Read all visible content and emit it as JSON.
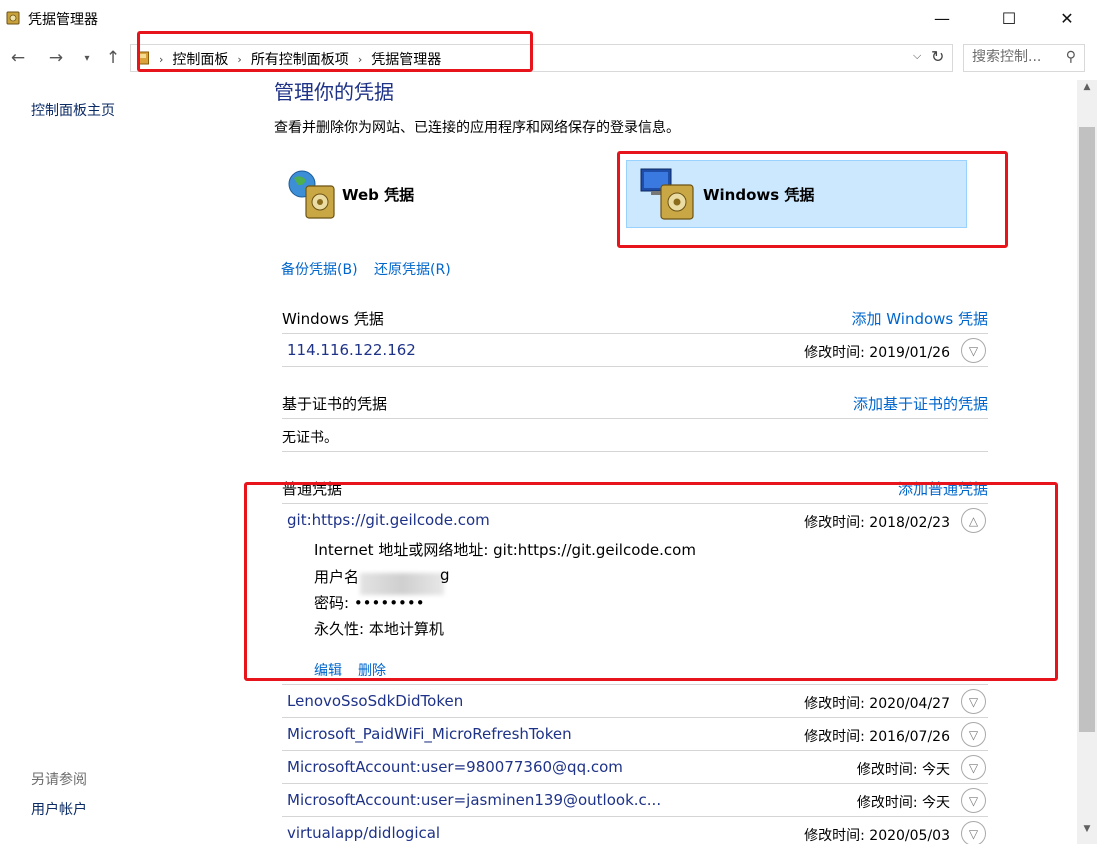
{
  "window": {
    "title": "凭据管理器",
    "minimize": "—",
    "maximize": "☐",
    "close": "✕"
  },
  "nav": {
    "back": "←",
    "forward": "→",
    "recent": "⌄",
    "up": "↑",
    "breadcrumbs": [
      "控制面板",
      "所有控制面板项",
      "凭据管理器"
    ],
    "separator": "›",
    "search_placeholder": "搜索控制...",
    "search_icon": "search-icon"
  },
  "sidebar": {
    "home": "控制面板主页",
    "see_also_title": "另请参阅",
    "see_also_items": [
      "用户帐户"
    ]
  },
  "main": {
    "heading": "管理你的凭据",
    "description": "查看并删除你为网站、已连接的应用程序和网络保存的登录信息。",
    "tiles": {
      "web": "Web 凭据",
      "windows": "Windows 凭据",
      "selected": "windows"
    },
    "backup": "备份凭据(B)",
    "restore": "还原凭据(R)"
  },
  "windows_creds": {
    "title": "Windows 凭据",
    "add": "添加 Windows 凭据",
    "items": [
      {
        "name": "114.116.122.162",
        "date": "修改时间: 2019/01/26"
      }
    ]
  },
  "cert_creds": {
    "title": "基于证书的凭据",
    "add": "添加基于证书的凭据",
    "empty": "无证书。"
  },
  "generic_creds": {
    "title": "普通凭据",
    "add": "添加普通凭据",
    "expanded": {
      "name": "git:https://git.geilcode.com",
      "date": "修改时间: 2018/02/23",
      "address_line": "Internet 地址或网络地址:  git:https://git.geilcode.com",
      "username_label": "用户名",
      "username_tail": "g",
      "password_line": "密码:  ••••••••",
      "persistence_line": "永久性:  本地计算机",
      "edit": "编辑",
      "delete": "删除"
    },
    "items": [
      {
        "name": "LenovoSsoSdkDidToken",
        "date": "修改时间: 2020/04/27"
      },
      {
        "name": "Microsoft_PaidWiFi_MicroRefreshToken",
        "date": "修改时间: 2016/07/26"
      },
      {
        "name": "MicrosoftAccount:user=980077360@qq.com",
        "date": "修改时间:  今天"
      },
      {
        "name": "MicrosoftAccount:user=jasminen139@outlook.c...",
        "date": "修改时间:  今天"
      },
      {
        "name": "virtualapp/didlogical",
        "date": "修改时间: 2020/05/03"
      }
    ]
  },
  "colors": {
    "link": "#0066cc",
    "heading": "#1e3287",
    "selected_tile": "#cce8ff",
    "annotation": "#e8141b"
  }
}
